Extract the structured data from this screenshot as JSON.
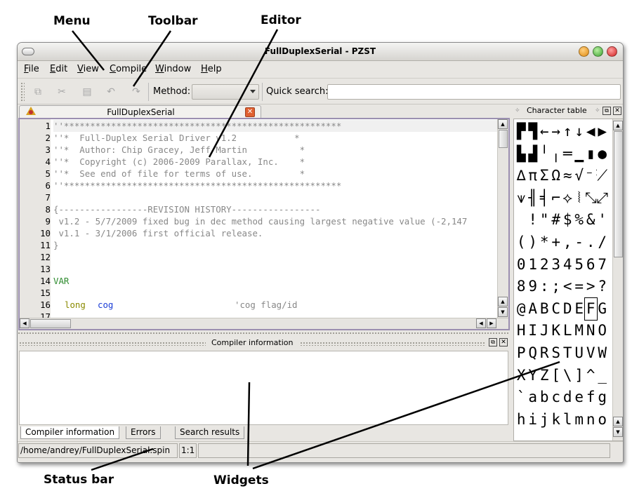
{
  "callouts": {
    "menu": "Menu",
    "toolbar": "Toolbar",
    "editor": "Editor",
    "status_bar": "Status bar",
    "widgets": "Widgets"
  },
  "window": {
    "title": "FullDuplexSerial - PZST"
  },
  "menu": [
    "File",
    "Edit",
    "View",
    "Compile",
    "Window",
    "Help"
  ],
  "toolbar": {
    "icons": [
      "copy-icon",
      "cut-icon",
      "paste-icon",
      "undo-icon",
      "redo-icon"
    ],
    "method_label": "Method:",
    "method_value": "",
    "quick_search_label": "Quick search:",
    "quick_search_value": ""
  },
  "editor": {
    "tab_label": "FullDuplexSerial",
    "line_numbers": [
      "1",
      "2",
      "3",
      "4",
      "5",
      "6",
      "7",
      "8",
      "9",
      "10",
      "11",
      "12",
      "13",
      "14",
      "15",
      "16",
      "17"
    ],
    "lines": [
      {
        "text": "''*****************************************************",
        "color": "#888888"
      },
      {
        "text": "''*  Full-Duplex Serial Driver v1.2           *",
        "color": "#888888"
      },
      {
        "text": "''*  Author: Chip Gracey, Jeff Martin          *",
        "color": "#888888"
      },
      {
        "text": "''*  Copyright (c) 2006-2009 Parallax, Inc.    *",
        "color": "#888888"
      },
      {
        "text": "''*  See end of file for terms of use.         *",
        "color": "#888888"
      },
      {
        "text": "''*****************************************************",
        "color": "#888888"
      },
      {
        "text": "",
        "color": "#888888"
      },
      {
        "text": "{-----------------REVISION HISTORY-----------------",
        "color": "#888888"
      },
      {
        "text": " v1.2 - 5/7/2009 fixed bug in dec method causing largest negative value (-2,147",
        "color": "#888888"
      },
      {
        "text": " v1.1 - 3/1/2006 first official release.",
        "color": "#888888"
      },
      {
        "text": "}",
        "color": "#888888"
      },
      {
        "text": "",
        "color": "#888888"
      },
      {
        "text": "",
        "color": "#888888"
      },
      {
        "text": "VAR",
        "color": "#2e8b2e"
      },
      {
        "text": "",
        "color": "#888888"
      }
    ],
    "line16": {
      "kw_long": "long",
      "kw_cog": "cog",
      "comment": "'cog flag/id"
    },
    "colors": {
      "keyword": "#8a8a00",
      "identifier": "#1a3cd6",
      "comment": "#888888",
      "section": "#2e8b2e"
    }
  },
  "compiler": {
    "title": "Compiler information",
    "tabs": [
      "Compiler information",
      "Errors",
      "Search results"
    ]
  },
  "status": {
    "path": "/home/andrey/FullDuplexSerial.spin",
    "position": "1:1"
  },
  "char_table": {
    "title": "Character table",
    "rows": [
      [
        "▛",
        "▜",
        "←",
        "→",
        "↑",
        "↓",
        "◀",
        "▶"
      ],
      [
        "▙",
        "▟",
        "╵",
        "╷",
        "═",
        "▁",
        "▮",
        "●"
      ],
      [
        "∆",
        "π",
        "Σ",
        "Ω",
        "≈",
        "√",
        "⁻¹",
        "⟋"
      ],
      [
        "⩛",
        "╢",
        "╡",
        "⌐",
        "⟡",
        "⦚",
        "⤡",
        "⤢"
      ],
      [
        " ",
        "!",
        "\"",
        "#",
        "$",
        "%",
        "&",
        "'"
      ],
      [
        "(",
        ")",
        "*",
        "+",
        ",",
        "-",
        ".",
        "/"
      ],
      [
        "0",
        "1",
        "2",
        "3",
        "4",
        "5",
        "6",
        "7"
      ],
      [
        "8",
        "9",
        ":",
        ";",
        "<",
        "=",
        ">",
        "?"
      ],
      [
        "@",
        "A",
        "B",
        "C",
        "D",
        "E",
        "F",
        "G"
      ],
      [
        "H",
        "I",
        "J",
        "K",
        "L",
        "M",
        "N",
        "O"
      ],
      [
        "P",
        "Q",
        "R",
        "S",
        "T",
        "U",
        "V",
        "W"
      ],
      [
        "X",
        "Y",
        "Z",
        "[",
        "\\",
        "]",
        "^",
        "_"
      ],
      [
        "`",
        "a",
        "b",
        "c",
        "d",
        "e",
        "f",
        "g"
      ],
      [
        "h",
        "i",
        "j",
        "k",
        "l",
        "m",
        "n",
        "o"
      ]
    ],
    "selected": "F"
  }
}
